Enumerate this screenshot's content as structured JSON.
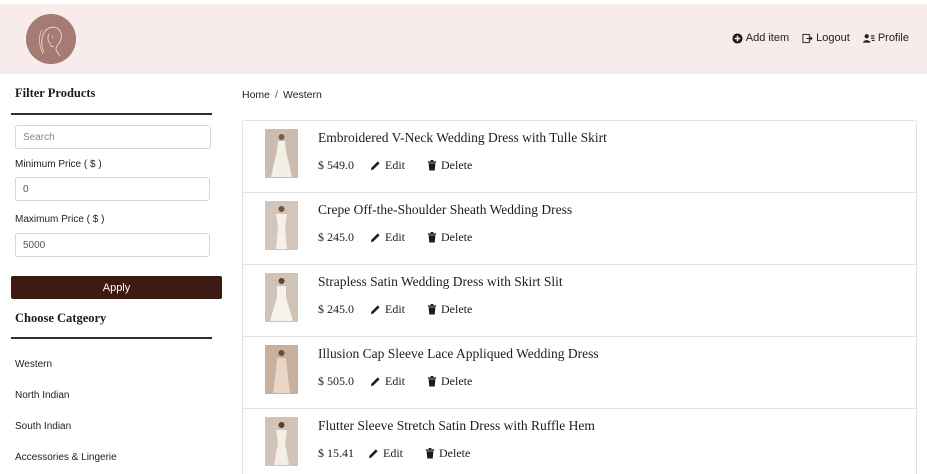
{
  "header": {
    "logo_icon": "woman-profile-logo-icon",
    "nav": [
      {
        "label": "Add item",
        "icon": "plus-circle-icon"
      },
      {
        "label": "Logout",
        "icon": "logout-icon"
      },
      {
        "label": "Profile",
        "icon": "user-list-icon"
      }
    ]
  },
  "sidebar": {
    "filter_title": "Filter Products",
    "search_placeholder": "Search",
    "min_label": "Minimum Price ( $ )",
    "min_value": "0",
    "max_label": "Maximum Price ( $ )",
    "max_value": "5000",
    "apply_label": "Apply",
    "category_title": "Choose Catgeory",
    "categories": [
      "Western",
      "North Indian",
      "South Indian",
      "Accessories & Lingerie"
    ]
  },
  "breadcrumb": {
    "home": "Home",
    "separator": "/",
    "current": "Western"
  },
  "products": [
    {
      "title": "Embroidered V-Neck Wedding Dress with Tulle Skirt",
      "price": "$ 549.0",
      "edit": "Edit",
      "delete": "Delete"
    },
    {
      "title": "Crepe Off-the-Shoulder Sheath Wedding Dress",
      "price": "$ 245.0",
      "edit": "Edit",
      "delete": "Delete"
    },
    {
      "title": "Strapless Satin Wedding Dress with Skirt Slit",
      "price": "$ 245.0",
      "edit": "Edit",
      "delete": "Delete"
    },
    {
      "title": "Illusion Cap Sleeve Lace Appliqued Wedding Dress",
      "price": "$ 505.0",
      "edit": "Edit",
      "delete": "Delete"
    },
    {
      "title": "Flutter Sleeve Stretch Satin Dress with Ruffle Hem",
      "price": "$ 15.41",
      "edit": "Edit",
      "delete": "Delete"
    }
  ],
  "colors": {
    "header_bg": "#f7ebeb",
    "apply_bg": "#3d1a12",
    "logo_bg": "#a57c74"
  }
}
